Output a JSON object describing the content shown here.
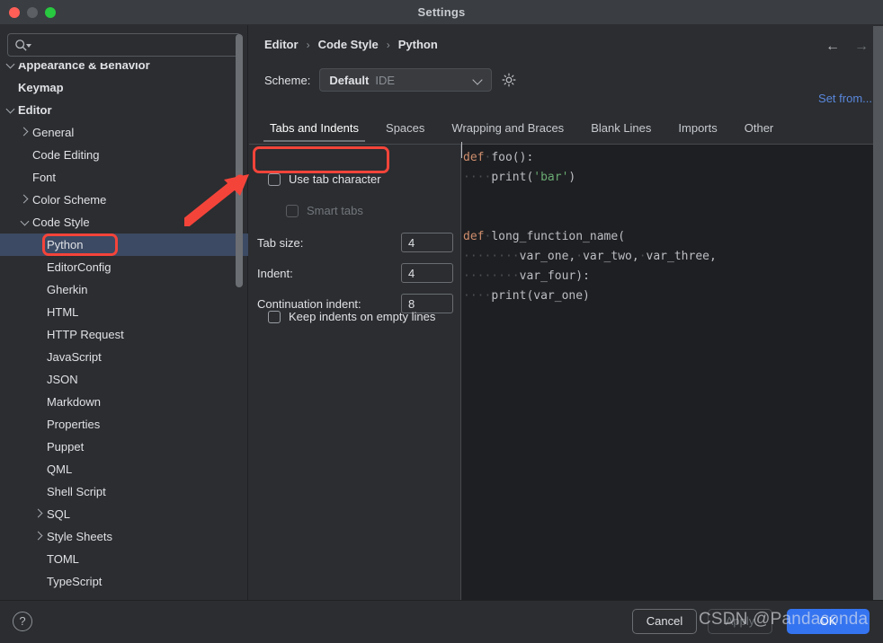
{
  "window": {
    "title": "Settings",
    "traffic_lights": [
      "close",
      "minimize",
      "maximize"
    ]
  },
  "sidebar": {
    "search": {
      "value": "",
      "placeholder": ""
    },
    "items": [
      {
        "label": "Appearance & Behavior",
        "depth": 0,
        "bold": true,
        "toggle": "down",
        "selected": false
      },
      {
        "label": "Keymap",
        "depth": 0,
        "bold": true,
        "toggle": "none",
        "selected": false
      },
      {
        "label": "Editor",
        "depth": 0,
        "bold": true,
        "toggle": "down",
        "selected": false
      },
      {
        "label": "General",
        "depth": 1,
        "bold": false,
        "toggle": "right",
        "selected": false
      },
      {
        "label": "Code Editing",
        "depth": 1,
        "bold": false,
        "toggle": "none",
        "selected": false
      },
      {
        "label": "Font",
        "depth": 1,
        "bold": false,
        "toggle": "none",
        "selected": false
      },
      {
        "label": "Color Scheme",
        "depth": 1,
        "bold": false,
        "toggle": "right",
        "selected": false
      },
      {
        "label": "Code Style",
        "depth": 1,
        "bold": false,
        "toggle": "down",
        "selected": false
      },
      {
        "label": "Python",
        "depth": 2,
        "bold": false,
        "toggle": "none",
        "selected": true
      },
      {
        "label": "EditorConfig",
        "depth": 2,
        "bold": false,
        "toggle": "none",
        "selected": false
      },
      {
        "label": "Gherkin",
        "depth": 2,
        "bold": false,
        "toggle": "none",
        "selected": false
      },
      {
        "label": "HTML",
        "depth": 2,
        "bold": false,
        "toggle": "none",
        "selected": false
      },
      {
        "label": "HTTP Request",
        "depth": 2,
        "bold": false,
        "toggle": "none",
        "selected": false
      },
      {
        "label": "JavaScript",
        "depth": 2,
        "bold": false,
        "toggle": "none",
        "selected": false
      },
      {
        "label": "JSON",
        "depth": 2,
        "bold": false,
        "toggle": "none",
        "selected": false
      },
      {
        "label": "Markdown",
        "depth": 2,
        "bold": false,
        "toggle": "none",
        "selected": false
      },
      {
        "label": "Properties",
        "depth": 2,
        "bold": false,
        "toggle": "none",
        "selected": false
      },
      {
        "label": "Puppet",
        "depth": 2,
        "bold": false,
        "toggle": "none",
        "selected": false
      },
      {
        "label": "QML",
        "depth": 2,
        "bold": false,
        "toggle": "none",
        "selected": false
      },
      {
        "label": "Shell Script",
        "depth": 2,
        "bold": false,
        "toggle": "none",
        "selected": false
      },
      {
        "label": "SQL",
        "depth": 2,
        "bold": false,
        "toggle": "right",
        "selected": false
      },
      {
        "label": "Style Sheets",
        "depth": 2,
        "bold": false,
        "toggle": "right",
        "selected": false
      },
      {
        "label": "TOML",
        "depth": 2,
        "bold": false,
        "toggle": "none",
        "selected": false
      },
      {
        "label": "TypeScript",
        "depth": 2,
        "bold": false,
        "toggle": "none",
        "selected": false
      }
    ]
  },
  "header": {
    "breadcrumb": [
      "Editor",
      "Code Style",
      "Python"
    ],
    "separator": "›",
    "back_icon": "arrow-left-icon",
    "forward_icon": "arrow-right-icon",
    "scheme_label": "Scheme:",
    "scheme_value": "Default",
    "scheme_scope": "IDE",
    "gear_icon": "gear-icon",
    "set_from_label": "Set from..."
  },
  "tabs": [
    {
      "label": "Tabs and Indents",
      "active": true
    },
    {
      "label": "Spaces",
      "active": false
    },
    {
      "label": "Wrapping and Braces",
      "active": false
    },
    {
      "label": "Blank Lines",
      "active": false
    },
    {
      "label": "Imports",
      "active": false
    },
    {
      "label": "Other",
      "active": false
    }
  ],
  "form": {
    "use_tab_character": {
      "label": "Use tab character",
      "checked": false,
      "disabled": false
    },
    "smart_tabs": {
      "label": "Smart tabs",
      "checked": false,
      "disabled": true
    },
    "tab_size": {
      "label": "Tab size:",
      "value": "4"
    },
    "indent": {
      "label": "Indent:",
      "value": "4"
    },
    "continuation_indent": {
      "label": "Continuation indent:",
      "value": "8"
    },
    "keep_indents_empty_lines": {
      "label": "Keep indents on empty lines",
      "checked": false,
      "disabled": false
    }
  },
  "preview": {
    "lines": [
      [
        {
          "t": "def",
          "c": "k"
        },
        {
          "t": "·",
          "c": "ws"
        },
        {
          "t": "foo():",
          "c": ""
        }
      ],
      [
        {
          "t": "····",
          "c": "ws"
        },
        {
          "t": "print(",
          "c": ""
        },
        {
          "t": "'bar'",
          "c": "s"
        },
        {
          "t": ")",
          "c": ""
        }
      ],
      [],
      [],
      [
        {
          "t": "def",
          "c": "k"
        },
        {
          "t": "·",
          "c": "ws"
        },
        {
          "t": "long_function_name(",
          "c": ""
        }
      ],
      [
        {
          "t": "········",
          "c": "ws"
        },
        {
          "t": "var_one,",
          "c": ""
        },
        {
          "t": "·",
          "c": "ws"
        },
        {
          "t": "var_two,",
          "c": ""
        },
        {
          "t": "·",
          "c": "ws"
        },
        {
          "t": "var_three,",
          "c": ""
        }
      ],
      [
        {
          "t": "········",
          "c": "ws"
        },
        {
          "t": "var_four):",
          "c": ""
        }
      ],
      [
        {
          "t": "····",
          "c": "ws"
        },
        {
          "t": "print(var_one)",
          "c": ""
        }
      ]
    ]
  },
  "footer": {
    "help_icon": "question-mark-icon",
    "cancel_label": "Cancel",
    "apply_label": "Apply",
    "ok_label": "OK",
    "accent_color": "#3574f0"
  },
  "watermark": {
    "text": "CSDN @Pandaconda"
  },
  "annotations": {
    "highlight_color": "#f4443a",
    "boxes": [
      "python-tree-item",
      "use-tab-character-checkbox"
    ],
    "arrow": "red-arrow-pointing-to-use-tab-character"
  }
}
